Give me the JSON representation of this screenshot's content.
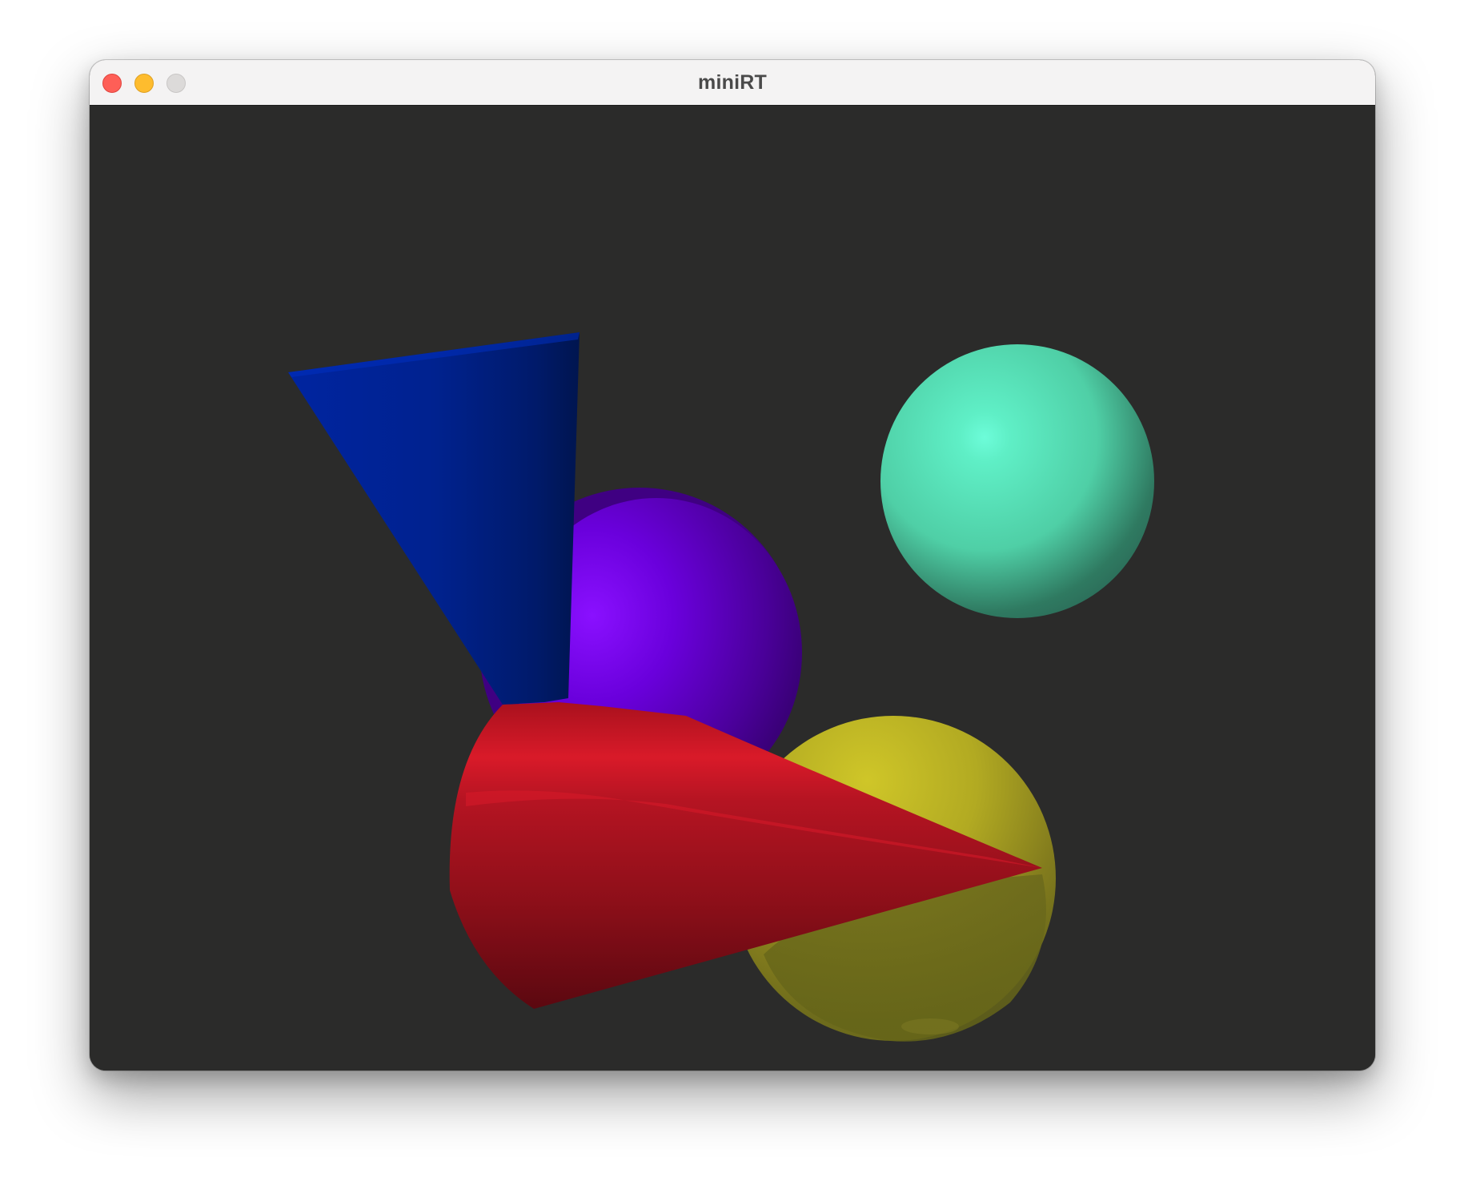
{
  "window": {
    "title": "miniRT",
    "controls": [
      "close",
      "minimize",
      "zoom"
    ]
  },
  "scene": {
    "background": "#2b2b2a",
    "objects": [
      {
        "name": "purple-sphere",
        "type": "sphere",
        "color": "#7b00ff"
      },
      {
        "name": "blue-cone",
        "type": "cone",
        "color": "#0025a8"
      },
      {
        "name": "mint-sphere",
        "type": "sphere",
        "color": "#5ff0c7"
      },
      {
        "name": "yellow-sphere",
        "type": "sphere",
        "color": "#d4cc26"
      },
      {
        "name": "red-cone",
        "type": "cone",
        "color": "#d91a29"
      }
    ]
  }
}
